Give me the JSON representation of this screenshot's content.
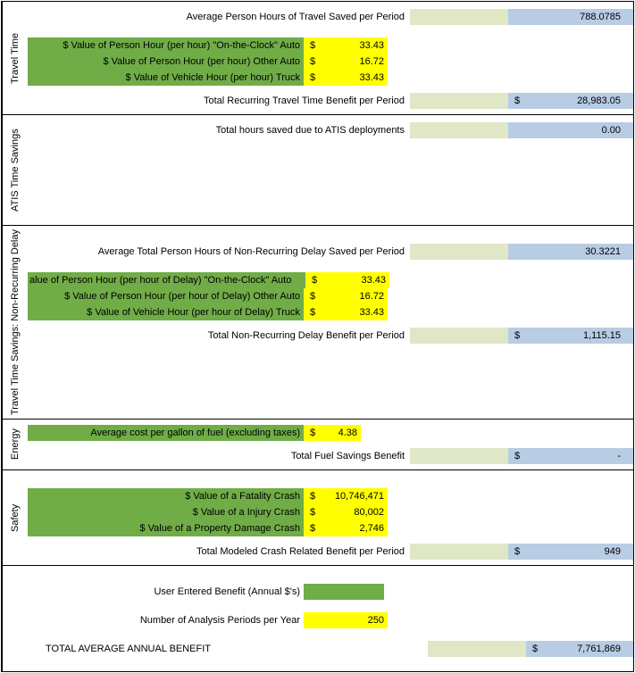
{
  "travelTime": {
    "heading": "Travel Time",
    "avgLabel": "Average Person Hours of Travel Saved per Period",
    "avgValue": "788.0785",
    "rows": [
      {
        "label": "$ Value of Person Hour (per hour) \"On-the-Clock\" Auto",
        "dollar": "$",
        "value": "33.43"
      },
      {
        "label": "$ Value of Person Hour (per hour) Other Auto",
        "dollar": "$",
        "value": "16.72"
      },
      {
        "label": "$ Value of Vehicle Hour (per hour) Truck",
        "dollar": "$",
        "value": "33.43"
      }
    ],
    "totalLabel": "Total Recurring Travel Time Benefit per Period",
    "totalDollar": "$",
    "totalValue": "28,983.05"
  },
  "atis": {
    "heading": "ATIS Time Savings",
    "label": "Total hours saved due to ATIS deployments",
    "value": "0.00"
  },
  "nonRecurring": {
    "heading": "Travel Time Savings: Non-Recurring Delay",
    "avgLabel": "Average Total Person Hours of Non-Recurring Delay Saved per Period",
    "avgValue": "30.3221",
    "rows": [
      {
        "label": "alue of Person Hour (per hour of Delay) \"On-the-Clock\" Auto",
        "dollar": "$",
        "value": "33.43"
      },
      {
        "label": "$ Value of Person Hour (per hour of Delay) Other Auto",
        "dollar": "$",
        "value": "16.72"
      },
      {
        "label": "$ Value of Vehicle Hour (per hour of Delay) Truck",
        "dollar": "$",
        "value": "33.43"
      }
    ],
    "totalLabel": "Total Non-Recurring Delay Benefit per Period",
    "totalDollar": "$",
    "totalValue": "1,115.15"
  },
  "energy": {
    "heading": "Energy",
    "rowLabel": "Average cost per gallon of fuel (excluding taxes)",
    "rowDollar": "$",
    "rowValue": "4.38",
    "totalLabel": "Total Fuel Savings Benefit",
    "totalDollar": "$",
    "totalValue": "-"
  },
  "safety": {
    "heading": "Safety",
    "rows": [
      {
        "label": "$ Value of a Fatality Crash",
        "dollar": "$",
        "value": "10,746,471"
      },
      {
        "label": "$ Value of a Injury Crash",
        "dollar": "$",
        "value": "80,002"
      },
      {
        "label": "$ Value of a Property Damage Crash",
        "dollar": "$",
        "value": "2,746"
      }
    ],
    "totalLabel": "Total Modeled Crash Related Benefit per Period",
    "totalDollar": "$",
    "totalValue": "949"
  },
  "bottom": {
    "userBenefitLabel": "User Entered Benefit (Annual $'s)",
    "periodsLabel": "Number of Analysis Periods per Year",
    "periodsValue": "250",
    "totalLabel": "TOTAL AVERAGE ANNUAL BENEFIT",
    "totalDollar": "$",
    "totalValue": "7,761,869"
  }
}
